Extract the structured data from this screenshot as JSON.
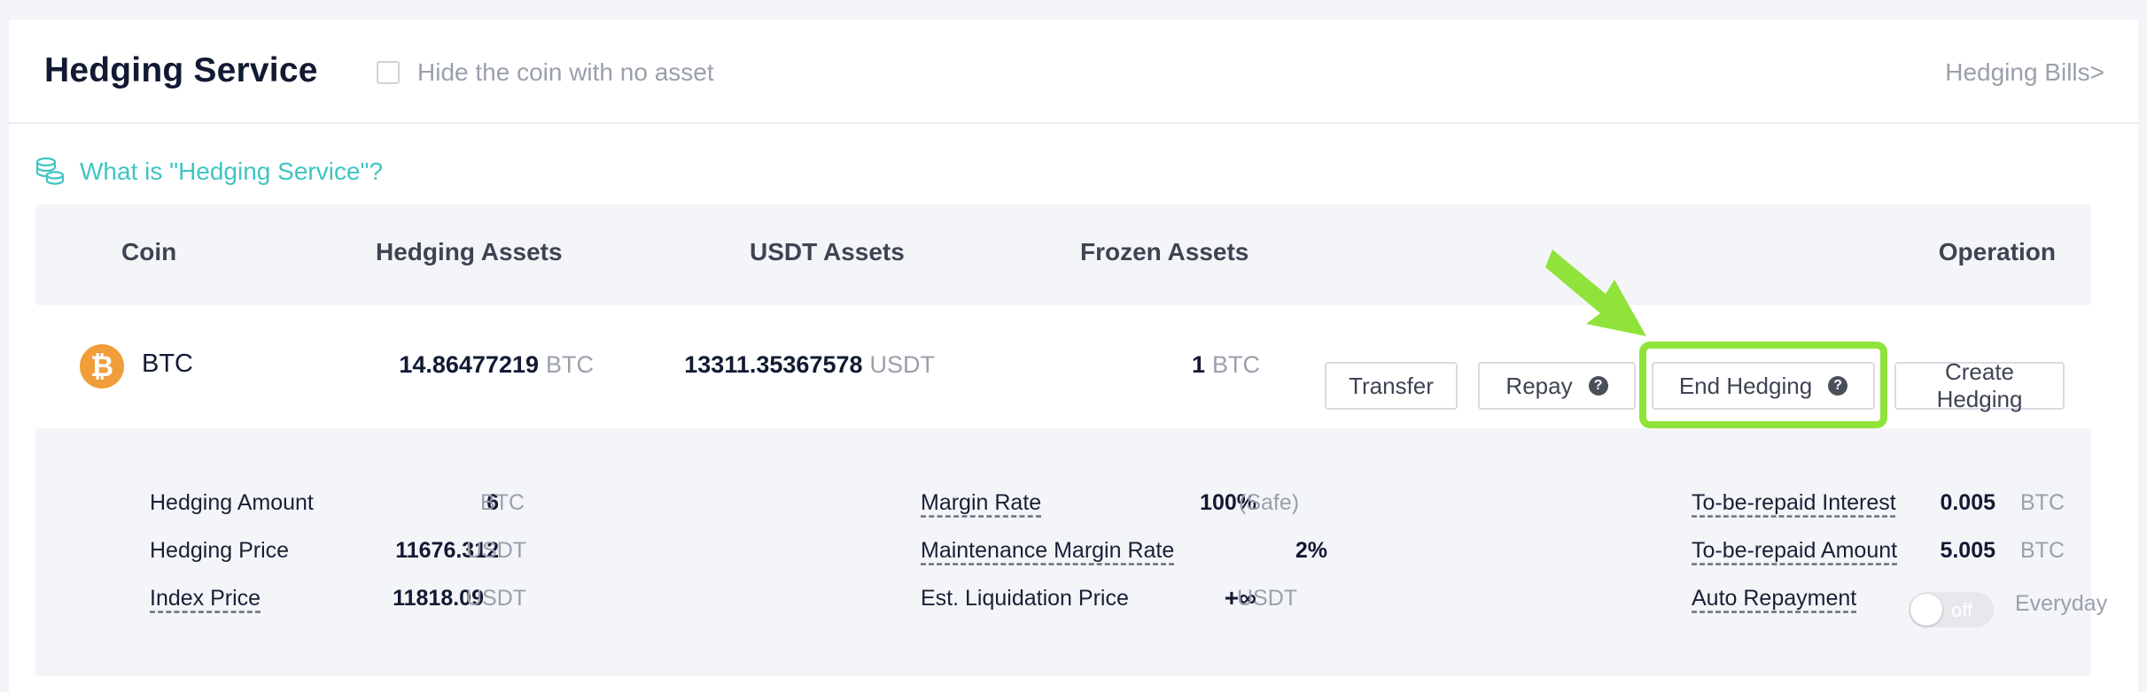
{
  "header": {
    "title": "Hedging Service",
    "hide_label": "Hide the coin with no asset",
    "bills_link": "Hedging Bills>"
  },
  "info_link": {
    "text": "What is \"Hedging Service\"?",
    "icon": "coins-stack-icon"
  },
  "table": {
    "columns": [
      "Coin",
      "Hedging Assets",
      "USDT Assets",
      "Frozen Assets",
      "Operation"
    ],
    "row": {
      "coin_icon": "bitcoin-icon",
      "coin_symbol": "₿",
      "coin": "BTC",
      "hedging_assets": {
        "value": "14.86477219",
        "unit": "BTC"
      },
      "usdt_assets": {
        "value": "13311.35367578",
        "unit": "USDT"
      },
      "frozen_assets": {
        "value": "1",
        "unit": "BTC"
      },
      "buttons": {
        "transfer": "Transfer",
        "repay": "Repay",
        "end_hedging": "End Hedging",
        "create_hedging": "Create Hedging",
        "help_glyph": "?"
      }
    }
  },
  "details": {
    "hedging_amount": {
      "label": "Hedging Amount",
      "value": "6",
      "unit": "BTC"
    },
    "hedging_price": {
      "label": "Hedging Price",
      "value": "11676.312",
      "unit": "USDT"
    },
    "index_price": {
      "label": "Index Price",
      "value": "11818.09",
      "unit": "USDT"
    },
    "margin_rate": {
      "label": "Margin Rate",
      "value": "100%",
      "note": "(Safe)"
    },
    "maintenance_margin_rate": {
      "label": "Maintenance Margin Rate",
      "value": "2%"
    },
    "liquidation_price": {
      "label": "Est. Liquidation Price",
      "value": "+∞",
      "unit": "USDT"
    },
    "interest": {
      "label": "To-be-repaid Interest",
      "value": "0.005",
      "unit": "BTC"
    },
    "repaid_amount": {
      "label": "To-be-repaid Amount",
      "value": "5.005",
      "unit": "BTC"
    },
    "auto_repayment": {
      "label": "Auto Repayment",
      "toggle_state": "off",
      "frequency": "Everyday"
    }
  },
  "colors": {
    "accent": "#40c4c4",
    "highlight": "#8fe33a",
    "bitcoin": "#f09d3a"
  }
}
